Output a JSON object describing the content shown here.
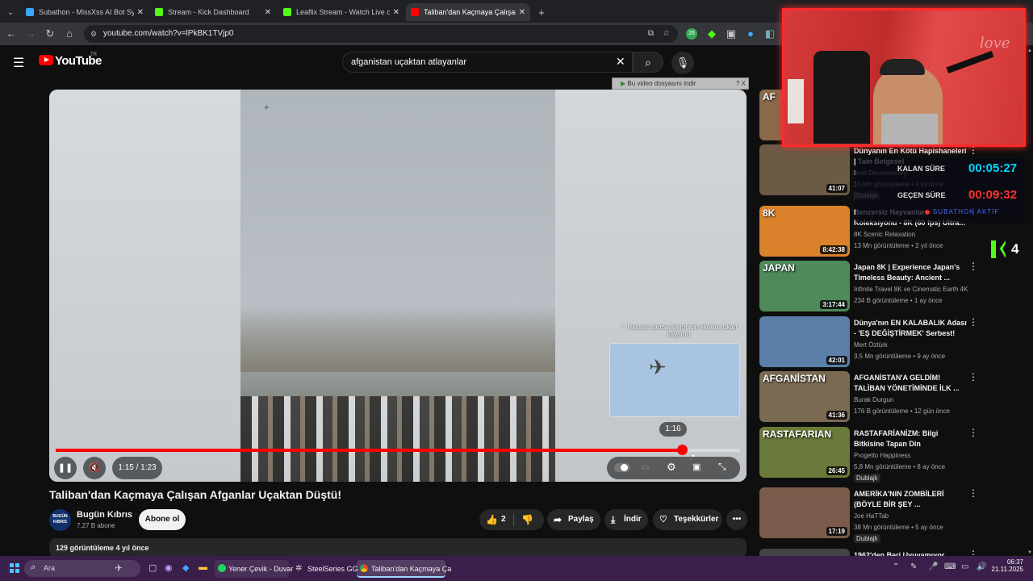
{
  "browser": {
    "tabs": [
      {
        "title": "Subathon - MissXss AI Bot Syste",
        "fav_color": "#3ea6ff"
      },
      {
        "title": "Stream - Kick Dashboard",
        "fav_color": "#53fc18"
      },
      {
        "title": "Leaflix Stream - Watch Live on K",
        "fav_color": "#53fc18"
      },
      {
        "title": "Taliban'dan Kaçmaya Çalışan Af",
        "fav_color": "#ff0000"
      }
    ],
    "url": "youtube.com/watch?v=lPkBK1TVjp0"
  },
  "youtube": {
    "logo": "YouTube",
    "logo_sup": "TR",
    "search_value": "afganistan uçaktan atlayanlar",
    "download_banner": "Bu video dosyasını indir",
    "download_banner_close": "? X",
    "player": {
      "time": "1:15 / 1:23",
      "hover_time": "1:16",
      "progress_fraction": 0.915,
      "hint": "Hassas sarma işlemi için ekranı yukarı kaydırın"
    },
    "video": {
      "title": "Taliban'dan Kaçmaya Çalışan Afganlar Uçaktan Düştü!",
      "channel": "Bugün Kıbrıs",
      "channel_avatar": "BUGÜN KIBRIS",
      "subscribers": "7,27 B abone",
      "subscribe_label": "Abone ol",
      "likes": "2",
      "share_label": "Paylaş",
      "download_label": "İndir",
      "thanks_label": "Teşekkürler",
      "views_line": "129 görüntüleme  4 yıl önce"
    },
    "recommendations": [
      {
        "title": "",
        "duration": "",
        "thumb": "#8a6a4a",
        "thumb_text": "AF",
        "channel": "",
        "meta": "",
        "dub": ""
      },
      {
        "title": "Dünyanın En Kötü Hapishaneleri | Tam Belgesel",
        "duration": "41:07",
        "thumb": "#6b5a44",
        "thumb_text": "",
        "channel": "Best Documentary",
        "meta": "16 Mn görüntüleme • 2 yıl önce",
        "dub": "Dublajlı"
      },
      {
        "title": "Benzersiz Hayvanlar Koleksiyonu - 8K (60 fps) Ultra...",
        "duration": "8:42:38",
        "thumb": "#d9822b",
        "thumb_text": "8K",
        "channel": "8K Scenic Relaxation",
        "meta": "13 Mn görüntüleme • 2 yıl önce",
        "dub": ""
      },
      {
        "title": "Japan 8K | Experience Japan's Timeless Beauty: Ancient ...",
        "duration": "3:17:44",
        "thumb": "#4e8a5a",
        "thumb_text": "JAPAN",
        "channel": "Infinite Travel 8K ve Cinematic Earth 4K",
        "meta": "234 B görüntüleme • 1 ay önce",
        "dub": ""
      },
      {
        "title": "Dünya'nın EN KALABALIK Adası - 'EŞ DEĞİŞTİRMEK' Serbest!",
        "duration": "42:01",
        "thumb": "#5b7fa8",
        "thumb_text": "",
        "channel": "Mert Öztürk",
        "meta": "3,5 Mn görüntüleme • 9 ay önce",
        "dub": ""
      },
      {
        "title": "AFGANİSTAN'A GELDİM! TALİBAN YÖNETİMİNDE İLK ...",
        "duration": "41:36",
        "thumb": "#7a6a52",
        "thumb_text": "AFGANİSTAN",
        "channel": "Burak Durgun",
        "meta": "176 B görüntüleme • 12 gün önce",
        "dub": ""
      },
      {
        "title": "RASTAFARİANİZM: Bilgi Bitkisine Tapan Din",
        "duration": "26:45",
        "thumb": "#6a7a3a",
        "thumb_text": "RASTAFARIAN",
        "channel": "Progetto Happiness",
        "meta": "5,8 Mn görüntüleme • 8 ay önce",
        "dub": "Dublajlı"
      },
      {
        "title": "AMERİKA'NIN ZOMBİLERİ (BÖYLE BİR ŞEY ...",
        "duration": "17:19",
        "thumb": "#7a5a4a",
        "thumb_text": "",
        "channel": "Joe HaTTab",
        "meta": "38 Mn görüntüleme • 5 ay önce",
        "dub": "Dublajlı"
      },
      {
        "title": "1962'den Beri Uyuyamıyor...",
        "duration": "",
        "thumb": "#444444",
        "thumb_text": "",
        "channel": "",
        "meta": "",
        "dub": ""
      }
    ]
  },
  "overlay": {
    "remaining_label": "KALAN SÜRE",
    "remaining_value": "00:05:27",
    "elapsed_label": "GEÇEN SÜRE",
    "elapsed_value": "00:09:32",
    "subathon_status": "SUBATHON AKTİF",
    "kick_count": "4"
  },
  "taskbar": {
    "search_placeholder": "Ara",
    "apps": [
      "Yener Çevik - Duvar",
      "SteelSeries GG",
      "Taliban'dan Kaçmaya Ça"
    ],
    "time": "06:37",
    "date": "21.11.2025"
  },
  "colors": {
    "accent": "#ff0000",
    "timer_cyan": "#00d4ff",
    "timer_red": "#ff3030",
    "kick_green": "#53fc18",
    "cam_border": "#ff2a2a"
  }
}
